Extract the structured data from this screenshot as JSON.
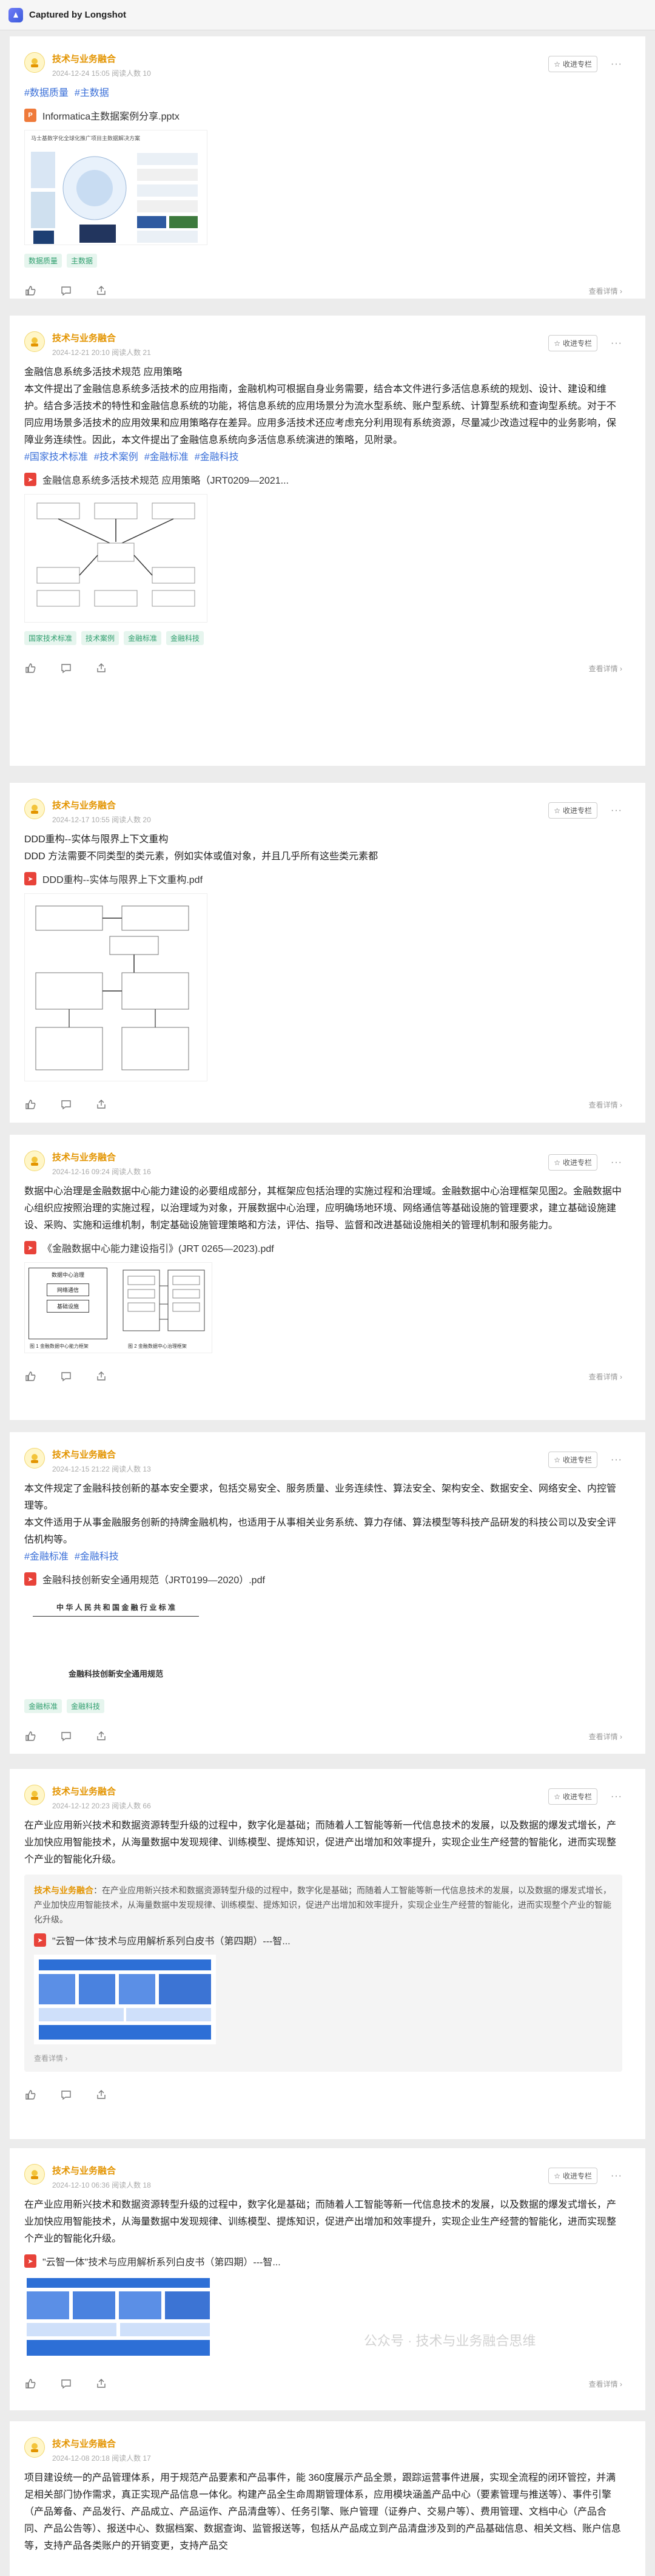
{
  "app": {
    "title": "Captured by Longshot"
  },
  "common": {
    "author": "技术与业务融合",
    "collect": "收进专栏",
    "more": "···",
    "detail": "查看详情 ›"
  },
  "posts": [
    {
      "meta": "2024-12-24 15:05  阅读人数 10",
      "hashtags": [
        "#数据质量",
        "#主数据"
      ],
      "file": {
        "name": "Informatica主数据案例分享.pptx",
        "type": "ppt"
      },
      "thumb_title": "马士基数字化全球化推广项目主数据解决方案",
      "tags": [
        "数据质量",
        "主数据"
      ]
    },
    {
      "meta": "2024-12-21 20:10  阅读人数 21",
      "body": [
        "金融信息系统多活技术规范 应用策略",
        "本文件提出了金融信息系统多活技术的应用指南，金融机构可根据自身业务需要，结合本文件进行多活信息系统的规划、设计、建设和维护。结合多活技术的特性和金融信息系统的功能，将信息系统的应用场景分为流水型系统、账户型系统、计算型系统和查询型系统。对于不同应用场景多活技术的应用效果和应用策略存在差异。应用多活技术还应考虑充分利用现有系统资源，尽量减少改造过程中的业务影响，保障业务连续性。因此，本文件提出了金融信息系统向多活信息系统演进的策略，见附录。"
      ],
      "hashtags": [
        "#国家技术标准",
        "#技术案例",
        "#金融标准",
        "#金融科技"
      ],
      "file": {
        "name": "金融信息系统多活技术规范 应用策略（JRT0209—2021...",
        "type": "pdf"
      },
      "tags": [
        "国家技术标准",
        "技术案例",
        "金融标准",
        "金融科技"
      ]
    },
    {
      "meta": "2024-12-17 10:55  阅读人数 20",
      "body": [
        "DDD重构--实体与限界上下文重构",
        "DDD 方法需要不同类型的类元素，例如实体或值对象，并且几乎所有这些类元素都"
      ],
      "file": {
        "name": "DDD重构--实体与限界上下文重构.pdf",
        "type": "pdf"
      }
    },
    {
      "meta": "2024-12-16 09:24  阅读人数 16",
      "body": [
        "数据中心治理是金融数据中心能力建设的必要组成部分，其框架应包括治理的实施过程和治理域。金融数据中心治理框架见图2。金融数据中心组织应按照治理的实施过程，以治理域为对象，开展数据中心治理，应明确场地环境、网络通信等基础设施的管理要求，建立基础设施建设、采购、实施和运维机制，制定基础设施管理策略和方法，评估、指导、监督和改进基础设施相关的管理机制和服务能力。"
      ],
      "file": {
        "name": "《金融数据中心能力建设指引》(JRT 0265—2023).pdf",
        "type": "pdf"
      },
      "thumb_labels": [
        "数据中心治理",
        "网络通信",
        "基础设施",
        "图 1  金融数据中心能力框架",
        "图 2  金融数据中心治理框架"
      ]
    },
    {
      "meta": "2024-12-15 21:22  阅读人数 13",
      "body": [
        "本文件规定了金融科技创新的基本安全要求，包括交易安全、服务质量、业务连续性、算法安全、架构安全、数据安全、网络安全、内控管理等。",
        "本文件适用于从事金融服务创新的持牌金融机构，也适用于从事相关业务系统、算力存储、算法模型等科技产品研发的科技公司以及安全评估机构等。"
      ],
      "hashtags": [
        "#金融标准",
        "#金融科技"
      ],
      "file": {
        "name": "金融科技创新安全通用规范（JRT0199—2020）.pdf",
        "type": "pdf"
      },
      "thumb_labels": [
        "中 华 人 民 共 和 国 金 融 行 业 标 准",
        "金融科技创新安全通用规范"
      ],
      "tags": [
        "金融标准",
        "金融科技"
      ]
    },
    {
      "meta": "2024-12-12 20:23  阅读人数 66",
      "body": [
        "在产业应用新兴技术和数据资源转型升级的过程中，数字化是基础；而随着人工智能等新一代信息技术的发展，以及数据的爆发式增长，产业加快应用智能技术，从海量数据中发现规律、训练模型、提炼知识，促进产出增加和效率提升，实现企业生产经营的智能化，进而实现整个产业的智能化升级。"
      ],
      "quote": {
        "author": "技术与业务融合",
        "text": "：在产业应用新兴技术和数据资源转型升级的过程中，数字化是基础；而随着人工智能等新一代信息技术的发展，以及数据的爆发式增长，产业加快应用智能技术，从海量数据中发现规律、训练模型、提炼知识，促进产出增加和效率提升，实现企业生产经营的智能化，进而实现整个产业的智能化升级。",
        "file": "\"云智一体\"技术与应用解析系列白皮书（第四期）---智...",
        "detail": "查看详情 ›"
      }
    },
    {
      "meta": "2024-12-10 06:36  阅读人数 18",
      "body": [
        "在产业应用新兴技术和数据资源转型升级的过程中，数字化是基础；而随着人工智能等新一代信息技术的发展，以及数据的爆发式增长，产业加快应用智能技术，从海量数据中发现规律、训练模型、提炼知识，促进产出增加和效率提升，实现企业生产经营的智能化，进而实现整个产业的智能化升级。"
      ],
      "file": {
        "name": "\"云智一体\"技术与应用解析系列白皮书（第四期）---智...",
        "type": "pdf"
      }
    },
    {
      "meta": "2024-12-08 20:18  阅读人数 17",
      "body": [
        "项目建设统一的产品管理体系，用于规范产品要素和产品事件，能 360度展示产品全景，跟踪运营事件进展，实现全流程的闭环管控，并满足相关部门协作需求，真正实现产品信息一体化。构建产品全生命周期管理体系，应用模块涵盖产品中心（要素管理与推送等）、事件引擎（产品筹备、产品发行、产品成立、产品运作、产品清盘等）、任务引擎、账户管理（证券户、交易户等）、费用管理、文档中心（产品合同、产品公告等）、报送中心、数据档案、数据查询、监管报送等，包括从产品成立到产品清盘涉及到的产品基础信息、相关文档、账户信息等，支持产品各类账户的开销变更，支持产品交"
      ]
    }
  ],
  "watermark": "公众号 · 技术与业务融合思维"
}
